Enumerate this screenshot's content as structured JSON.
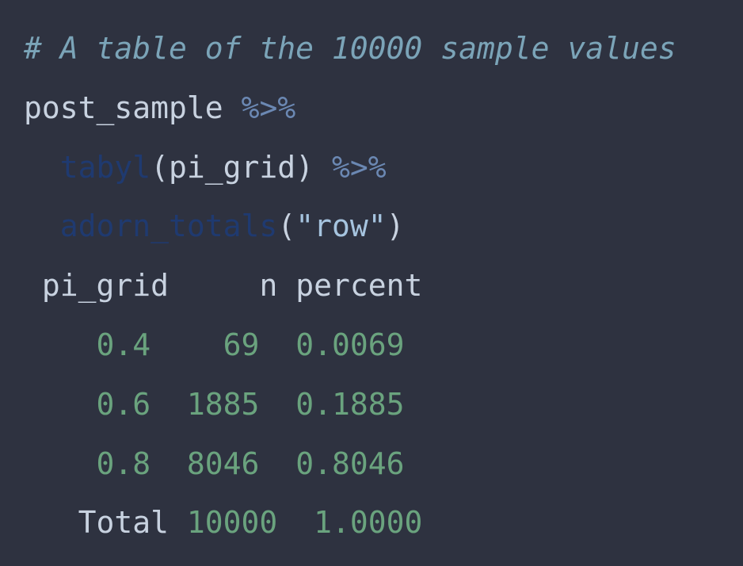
{
  "code": {
    "comment": "# A table of the 10000 sample values",
    "line1": {
      "obj": "post_sample",
      "pipe": "%>%"
    },
    "line2": {
      "indent": "  ",
      "fn": "tabyl",
      "args": "(pi_grid)",
      "space": " ",
      "pipe": "%>%"
    },
    "line3": {
      "indent": "  ",
      "fn": "adorn_totals",
      "open": "(",
      "arg": "\"row\"",
      "close": ")"
    }
  },
  "output": {
    "columns": [
      "pi_grid",
      "n",
      "percent"
    ],
    "rows": [
      {
        "pi_grid": "0.4",
        "n": "69",
        "percent": "0.0069"
      },
      {
        "pi_grid": "0.6",
        "n": "1885",
        "percent": "0.1885"
      },
      {
        "pi_grid": "0.8",
        "n": "8046",
        "percent": "0.8046"
      },
      {
        "pi_grid": "Total",
        "n": "10000",
        "percent": "1.0000"
      }
    ]
  },
  "colors": {
    "background": "#2e3240",
    "comment": "#7ba4b8",
    "pipe": "#6b88b3",
    "function": "#1f3a70",
    "number": "#6aa37e",
    "text": "#c8d2e0"
  }
}
